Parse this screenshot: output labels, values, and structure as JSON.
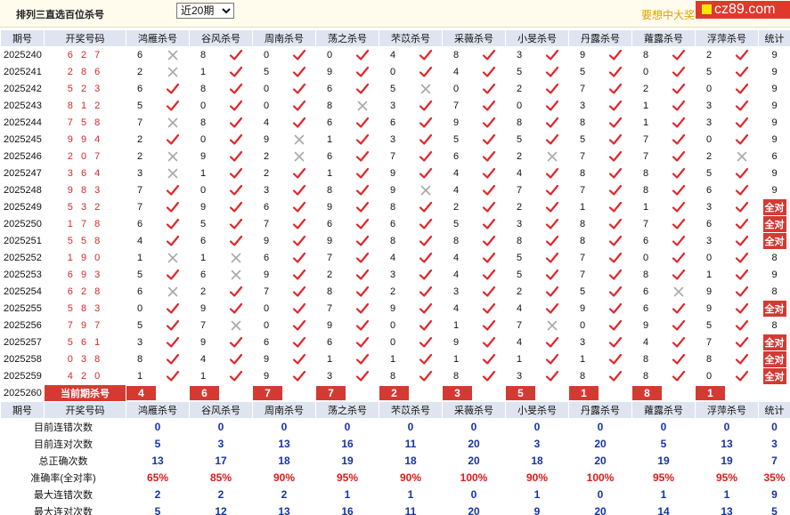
{
  "title": "排列三直选百位杀号",
  "period_select": {
    "selected": "近20期"
  },
  "slogan": "要想中大奖",
  "logo": "cz89.com",
  "headers": [
    "期号",
    "开奖号码",
    "鸿雁杀号",
    "谷风杀号",
    "周南杀号",
    "荡之杀号",
    "芣苡杀号",
    "采薇杀号",
    "小旻杀号",
    "丹露杀号",
    "蕹露杀号",
    "浮萍杀号",
    "统计"
  ],
  "rows": [
    {
      "p": "2025240",
      "n": "6 2 7",
      "k": [
        [
          6,
          0
        ],
        [
          8,
          1
        ],
        [
          0,
          1
        ],
        [
          0,
          1
        ],
        [
          4,
          1
        ],
        [
          8,
          1
        ],
        [
          3,
          1
        ],
        [
          9,
          1
        ],
        [
          8,
          1
        ],
        [
          2,
          1
        ]
      ],
      "t": "9"
    },
    {
      "p": "2025241",
      "n": "2 8 6",
      "k": [
        [
          2,
          0
        ],
        [
          1,
          1
        ],
        [
          5,
          1
        ],
        [
          9,
          1
        ],
        [
          0,
          1
        ],
        [
          4,
          1
        ],
        [
          5,
          1
        ],
        [
          5,
          1
        ],
        [
          0,
          1
        ],
        [
          5,
          1
        ]
      ],
      "t": "9"
    },
    {
      "p": "2025242",
      "n": "5 2 3",
      "k": [
        [
          6,
          1
        ],
        [
          8,
          1
        ],
        [
          0,
          1
        ],
        [
          6,
          1
        ],
        [
          5,
          0
        ],
        [
          0,
          1
        ],
        [
          2,
          1
        ],
        [
          7,
          1
        ],
        [
          2,
          1
        ],
        [
          0,
          1
        ]
      ],
      "t": "9"
    },
    {
      "p": "2025243",
      "n": "8 1 2",
      "k": [
        [
          5,
          1
        ],
        [
          0,
          1
        ],
        [
          0,
          1
        ],
        [
          8,
          0
        ],
        [
          3,
          1
        ],
        [
          7,
          1
        ],
        [
          0,
          1
        ],
        [
          3,
          1
        ],
        [
          1,
          1
        ],
        [
          3,
          1
        ]
      ],
      "t": "9"
    },
    {
      "p": "2025244",
      "n": "7 5 8",
      "k": [
        [
          7,
          0
        ],
        [
          8,
          1
        ],
        [
          4,
          1
        ],
        [
          6,
          1
        ],
        [
          6,
          1
        ],
        [
          9,
          1
        ],
        [
          8,
          1
        ],
        [
          8,
          1
        ],
        [
          1,
          1
        ],
        [
          3,
          1
        ]
      ],
      "t": "9"
    },
    {
      "p": "2025245",
      "n": "9 9 4",
      "k": [
        [
          2,
          1
        ],
        [
          0,
          1
        ],
        [
          9,
          0
        ],
        [
          1,
          1
        ],
        [
          3,
          1
        ],
        [
          5,
          1
        ],
        [
          5,
          1
        ],
        [
          5,
          1
        ],
        [
          7,
          1
        ],
        [
          0,
          1
        ]
      ],
      "t": "9"
    },
    {
      "p": "2025246",
      "n": "2 0 7",
      "k": [
        [
          2,
          0
        ],
        [
          9,
          1
        ],
        [
          2,
          0
        ],
        [
          6,
          1
        ],
        [
          7,
          1
        ],
        [
          6,
          1
        ],
        [
          2,
          0
        ],
        [
          7,
          1
        ],
        [
          7,
          1
        ],
        [
          2,
          0
        ]
      ],
      "t": "6"
    },
    {
      "p": "2025247",
      "n": "3 6 4",
      "k": [
        [
          3,
          0
        ],
        [
          1,
          1
        ],
        [
          2,
          1
        ],
        [
          1,
          1
        ],
        [
          9,
          1
        ],
        [
          4,
          1
        ],
        [
          4,
          1
        ],
        [
          8,
          1
        ],
        [
          8,
          1
        ],
        [
          5,
          1
        ]
      ],
      "t": "9"
    },
    {
      "p": "2025248",
      "n": "9 8 3",
      "k": [
        [
          7,
          1
        ],
        [
          0,
          1
        ],
        [
          3,
          1
        ],
        [
          8,
          1
        ],
        [
          9,
          0
        ],
        [
          4,
          1
        ],
        [
          7,
          1
        ],
        [
          7,
          1
        ],
        [
          8,
          1
        ],
        [
          6,
          1
        ]
      ],
      "t": "9"
    },
    {
      "p": "2025249",
      "n": "5 3 2",
      "k": [
        [
          7,
          1
        ],
        [
          9,
          1
        ],
        [
          6,
          1
        ],
        [
          9,
          1
        ],
        [
          8,
          1
        ],
        [
          2,
          1
        ],
        [
          2,
          1
        ],
        [
          1,
          1
        ],
        [
          1,
          1
        ],
        [
          3,
          1
        ]
      ],
      "t": "全对"
    },
    {
      "p": "2025250",
      "n": "1 7 8",
      "k": [
        [
          6,
          1
        ],
        [
          5,
          1
        ],
        [
          7,
          1
        ],
        [
          6,
          1
        ],
        [
          6,
          1
        ],
        [
          5,
          1
        ],
        [
          3,
          1
        ],
        [
          8,
          1
        ],
        [
          7,
          1
        ],
        [
          6,
          1
        ]
      ],
      "t": "全对"
    },
    {
      "p": "2025251",
      "n": "5 5 8",
      "k": [
        [
          4,
          1
        ],
        [
          6,
          1
        ],
        [
          9,
          1
        ],
        [
          9,
          1
        ],
        [
          8,
          1
        ],
        [
          8,
          1
        ],
        [
          8,
          1
        ],
        [
          8,
          1
        ],
        [
          6,
          1
        ],
        [
          3,
          1
        ]
      ],
      "t": "全对"
    },
    {
      "p": "2025252",
      "n": "1 9 0",
      "k": [
        [
          1,
          0
        ],
        [
          1,
          0
        ],
        [
          6,
          1
        ],
        [
          7,
          1
        ],
        [
          4,
          1
        ],
        [
          4,
          1
        ],
        [
          5,
          1
        ],
        [
          7,
          1
        ],
        [
          0,
          1
        ],
        [
          0,
          1
        ]
      ],
      "t": "8"
    },
    {
      "p": "2025253",
      "n": "6 9 3",
      "k": [
        [
          5,
          1
        ],
        [
          6,
          0
        ],
        [
          9,
          1
        ],
        [
          2,
          1
        ],
        [
          3,
          1
        ],
        [
          4,
          1
        ],
        [
          5,
          1
        ],
        [
          7,
          1
        ],
        [
          8,
          1
        ],
        [
          1,
          1
        ]
      ],
      "t": "9"
    },
    {
      "p": "2025254",
      "n": "6 2 8",
      "k": [
        [
          6,
          0
        ],
        [
          2,
          1
        ],
        [
          7,
          1
        ],
        [
          8,
          1
        ],
        [
          2,
          1
        ],
        [
          3,
          1
        ],
        [
          2,
          1
        ],
        [
          5,
          1
        ],
        [
          6,
          0
        ],
        [
          9,
          1
        ]
      ],
      "t": "8"
    },
    {
      "p": "2025255",
      "n": "5 8 3",
      "k": [
        [
          0,
          1
        ],
        [
          9,
          1
        ],
        [
          0,
          1
        ],
        [
          7,
          1
        ],
        [
          9,
          1
        ],
        [
          4,
          1
        ],
        [
          4,
          1
        ],
        [
          9,
          1
        ],
        [
          6,
          1
        ],
        [
          9,
          1
        ]
      ],
      "t": "全对"
    },
    {
      "p": "2025256",
      "n": "7 9 7",
      "k": [
        [
          5,
          1
        ],
        [
          7,
          0
        ],
        [
          0,
          1
        ],
        [
          9,
          1
        ],
        [
          0,
          1
        ],
        [
          1,
          1
        ],
        [
          7,
          0
        ],
        [
          0,
          1
        ],
        [
          9,
          1
        ],
        [
          5,
          1
        ]
      ],
      "t": "8"
    },
    {
      "p": "2025257",
      "n": "5 6 1",
      "k": [
        [
          3,
          1
        ],
        [
          9,
          1
        ],
        [
          6,
          1
        ],
        [
          6,
          1
        ],
        [
          0,
          1
        ],
        [
          9,
          1
        ],
        [
          4,
          1
        ],
        [
          3,
          1
        ],
        [
          4,
          1
        ],
        [
          7,
          1
        ]
      ],
      "t": "全对"
    },
    {
      "p": "2025258",
      "n": "0 3 8",
      "k": [
        [
          8,
          1
        ],
        [
          4,
          1
        ],
        [
          9,
          1
        ],
        [
          1,
          1
        ],
        [
          1,
          1
        ],
        [
          1,
          1
        ],
        [
          1,
          1
        ],
        [
          1,
          1
        ],
        [
          8,
          1
        ],
        [
          8,
          1
        ]
      ],
      "t": "全对"
    },
    {
      "p": "2025259",
      "n": "4 2 0",
      "k": [
        [
          1,
          1
        ],
        [
          1,
          1
        ],
        [
          9,
          1
        ],
        [
          3,
          1
        ],
        [
          8,
          1
        ],
        [
          8,
          1
        ],
        [
          3,
          1
        ],
        [
          8,
          1
        ],
        [
          8,
          1
        ],
        [
          0,
          1
        ]
      ],
      "t": "全对"
    }
  ],
  "current": {
    "p": "2025260",
    "label": "当前期杀号",
    "k": [
      "4",
      "6",
      "7",
      "7",
      "2",
      "3",
      "5",
      "1",
      "8",
      "1"
    ]
  },
  "stats": [
    {
      "label": "目前连错次数",
      "v": [
        "0",
        "0",
        "0",
        "0",
        "0",
        "0",
        "0",
        "0",
        "0",
        "0",
        "0"
      ]
    },
    {
      "label": "目前连对次数",
      "v": [
        "5",
        "3",
        "13",
        "16",
        "11",
        "20",
        "3",
        "20",
        "5",
        "13",
        "3"
      ]
    },
    {
      "label": "总正确次数",
      "v": [
        "13",
        "17",
        "18",
        "19",
        "18",
        "20",
        "18",
        "20",
        "19",
        "19",
        "7"
      ]
    },
    {
      "label": "准确率(全对率)",
      "v": [
        "65%",
        "85%",
        "90%",
        "95%",
        "90%",
        "100%",
        "90%",
        "100%",
        "95%",
        "95%",
        "35%"
      ]
    },
    {
      "label": "最大连错次数",
      "v": [
        "2",
        "2",
        "2",
        "1",
        "1",
        "0",
        "1",
        "0",
        "1",
        "1",
        "9"
      ]
    },
    {
      "label": "最大连对次数",
      "v": [
        "5",
        "12",
        "13",
        "16",
        "11",
        "20",
        "9",
        "20",
        "14",
        "13",
        "5"
      ]
    }
  ]
}
